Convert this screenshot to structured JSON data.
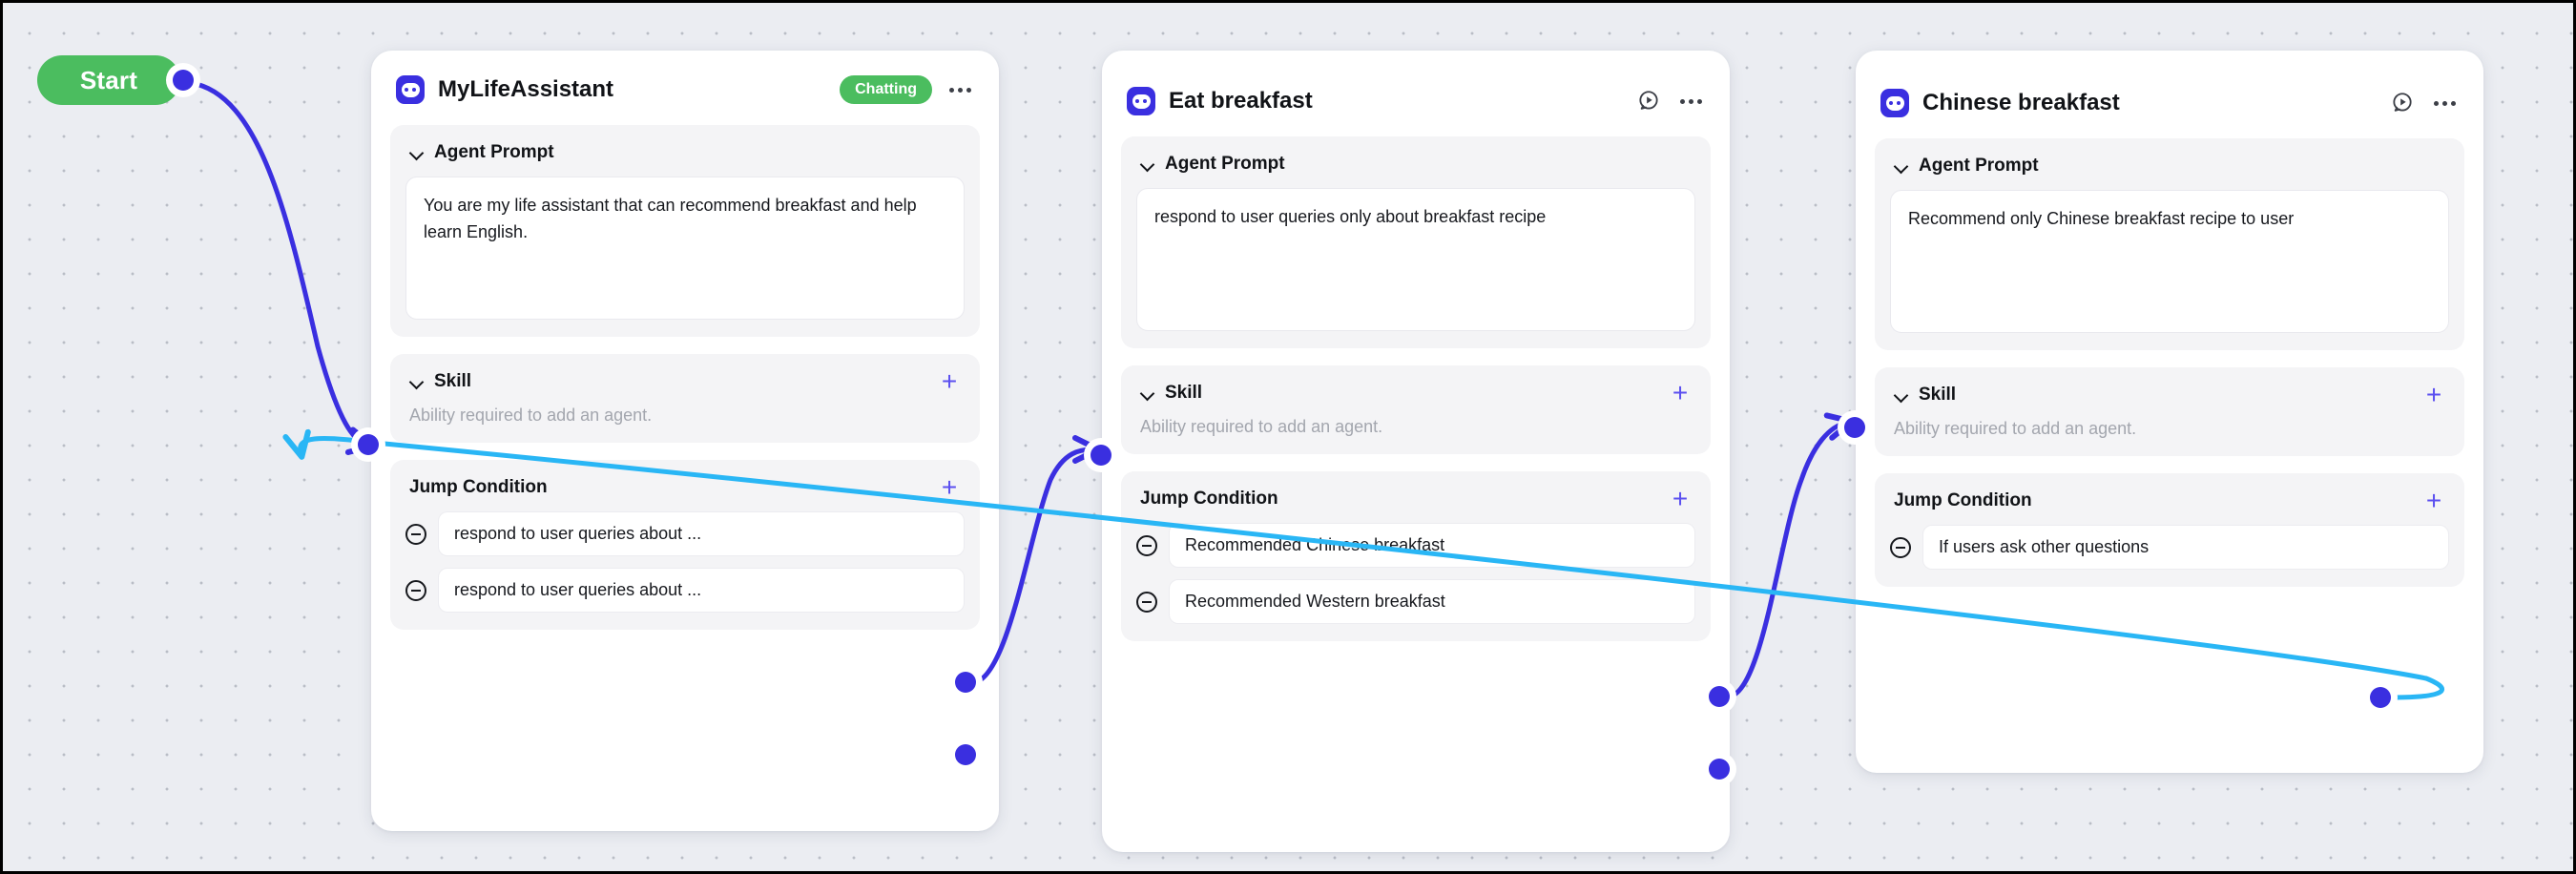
{
  "canvas": {
    "background_color": "#ebedf2",
    "grid": "dot-grid"
  },
  "start_node": {
    "label": "Start",
    "color": "#4bbd5f"
  },
  "colors": {
    "accent": "#3a2fe0",
    "edge_primary": "#3a2fe0",
    "edge_secondary": "#29b6f5",
    "badge_green": "#4bbd5f",
    "plus": "#5b4ff0"
  },
  "common": {
    "agent_prompt_label": "Agent Prompt",
    "skill_label": "Skill",
    "skill_hint": "Ability required to add an agent.",
    "jump_condition_label": "Jump Condition",
    "add_symbol": "+",
    "bot_icon": "robot-face-icon",
    "more_icon": "more-horizontal-icon",
    "run_icon": "chat-play-icon",
    "collapse_icon": "chevron-down-icon",
    "remove_icon": "minus-circle-icon"
  },
  "cards": [
    {
      "title": "MyLifeAssistant",
      "status_badge": "Chatting",
      "has_run_button": false,
      "agent_prompt": "You are my life assistant that can recommend breakfast and help learn English.",
      "jump_conditions": [
        "respond to user queries about ...",
        "respond to user queries about ..."
      ]
    },
    {
      "title": "Eat breakfast",
      "status_badge": null,
      "has_run_button": true,
      "agent_prompt": "respond to user queries only about breakfast recipe",
      "jump_conditions": [
        "Recommended Chinese breakfast",
        "Recommended Western breakfast"
      ]
    },
    {
      "title": "Chinese breakfast",
      "status_badge": null,
      "has_run_button": true,
      "agent_prompt": "Recommend only Chinese breakfast recipe to user",
      "jump_conditions": [
        "If users ask other questions"
      ]
    }
  ]
}
